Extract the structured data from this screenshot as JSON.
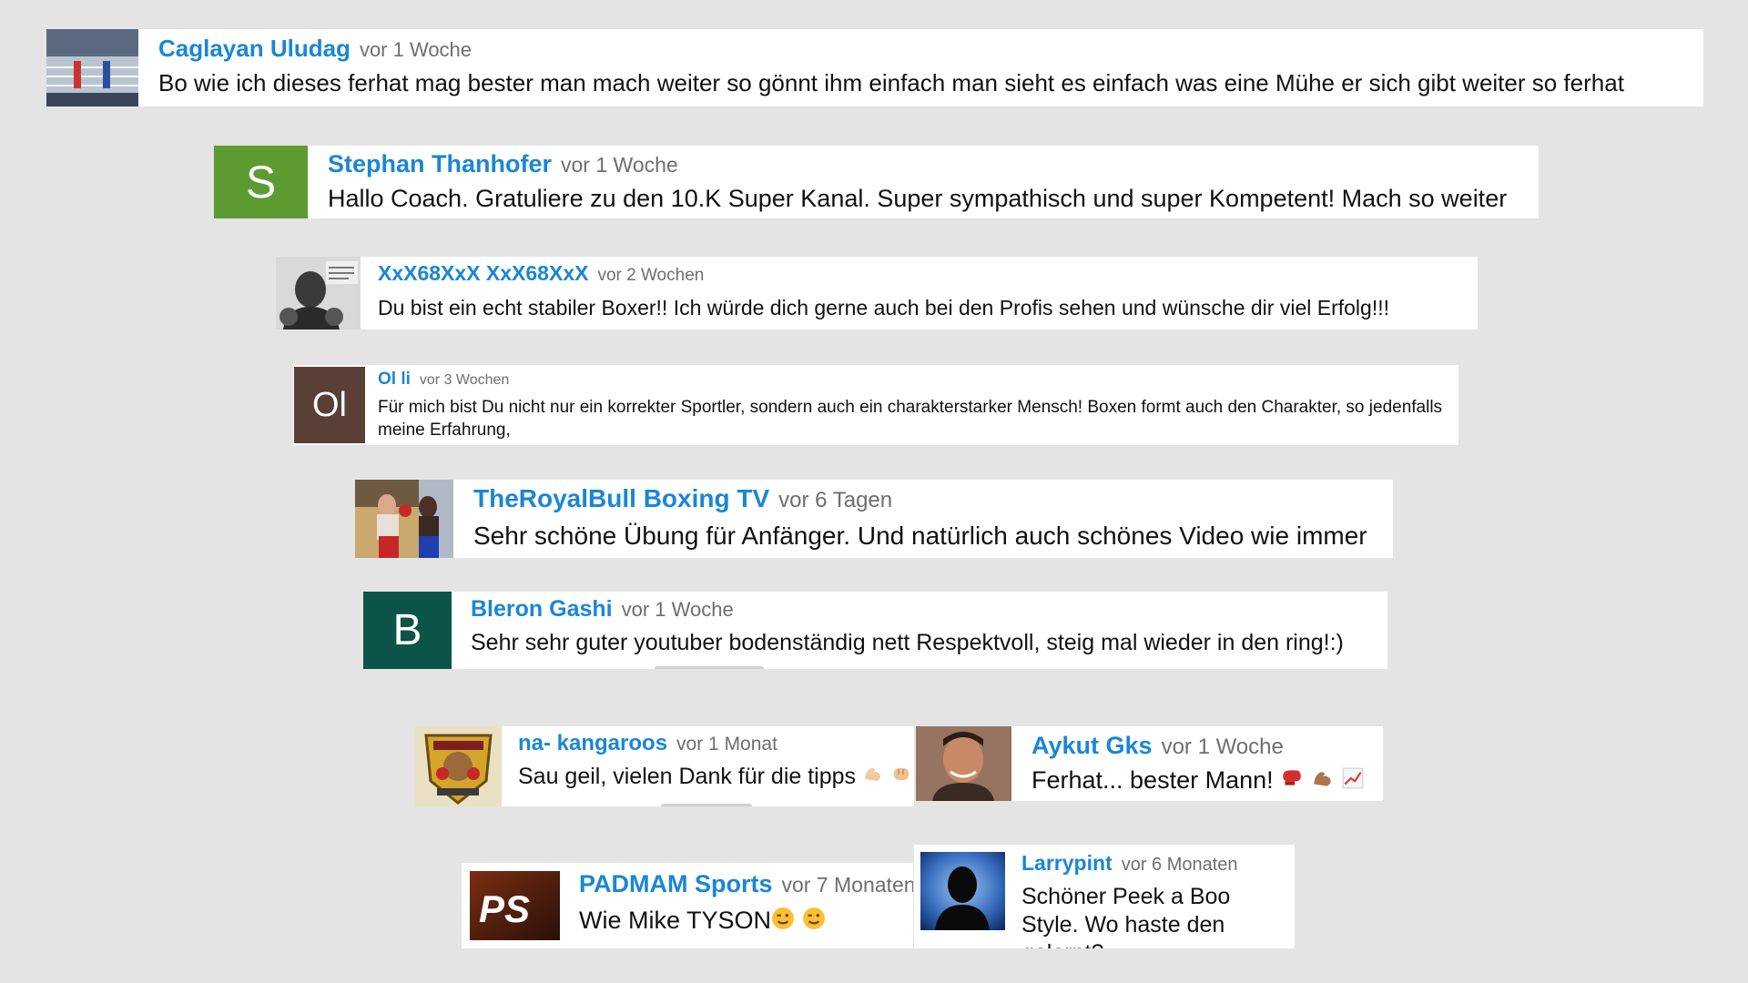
{
  "comments": [
    {
      "author": "Caglayan Uludag",
      "time": "vor 1 Woche",
      "text": "Bo wie ich dieses ferhat mag bester man mach weiter so gönnt ihm einfach man sieht es einfach was eine Mühe er sich gibt weiter so ferhat",
      "avatar_icon": "boxing-ring-photo-icon"
    },
    {
      "author": "Stephan Thanhofer",
      "time": "vor 1 Woche",
      "text": "Hallo Coach. Gratuliere zu den 10.K Super Kanal. Super sympathisch und super Kompetent! Mach so weiter",
      "avatar_letter": "S",
      "avatar_color": "#5b9b30"
    },
    {
      "author": "XxX68XxX XxX68XxX",
      "time": "vor 2 Wochen",
      "text": "Du bist ein echt stabiler Boxer!! Ich würde dich gerne auch bei den Profis sehen und wünsche dir viel Erfolg!!!",
      "avatar_icon": "boxer-portrait-photo-icon"
    },
    {
      "author": "Ol li",
      "time": "vor 3 Wochen",
      "text": "Für mich bist Du nicht nur ein korrekter Sportler, sondern auch ein charakterstarker Mensch! Boxen formt auch den Charakter, so jedenfalls meine Erfahrung,",
      "avatar_letter": "Ol",
      "avatar_color": "#5a3f37"
    },
    {
      "author": "TheRoyalBull Boxing TV",
      "time": "vor 6 Tagen",
      "text": "Sehr schöne Übung für Anfänger. Und natürlich auch schönes Video wie immer",
      "avatar_icon": "boxing-match-photo-icon"
    },
    {
      "author": "Bleron Gashi",
      "time": "vor 1 Woche",
      "text": "Sehr sehr guter youtuber bodenständig nett Respektvoll, steig mal wieder in den ring!:)",
      "avatar_letter": "B",
      "avatar_color": "#0b5447"
    },
    {
      "author": "na- kangaroos",
      "time": "vor 1 Monat",
      "text": "Sau geil, vielen Dank für die tipps",
      "avatar_icon": "kangaroo-logo-icon"
    },
    {
      "author": "Aykut Gks",
      "time": "vor 1 Woche",
      "text": "Ferhat... bester Mann!",
      "avatar_icon": "man-portrait-photo-icon"
    },
    {
      "author": "PADMAM Sports",
      "time": "vor 7 Monaten",
      "text": "Wie Mike TYSON",
      "avatar_letter": "PS",
      "avatar_icon": "ps-logo-icon"
    },
    {
      "author": "Larrypint",
      "time": "vor 6 Monaten",
      "text": "Schöner Peek a Boo Style. Wo haste den gelernt?",
      "avatar_icon": "silhouette-avatar-icon"
    }
  ],
  "colors": {
    "author": "#1a86d6",
    "time": "#6e6e6e",
    "text": "#111111",
    "background": "#e4e4e4"
  }
}
